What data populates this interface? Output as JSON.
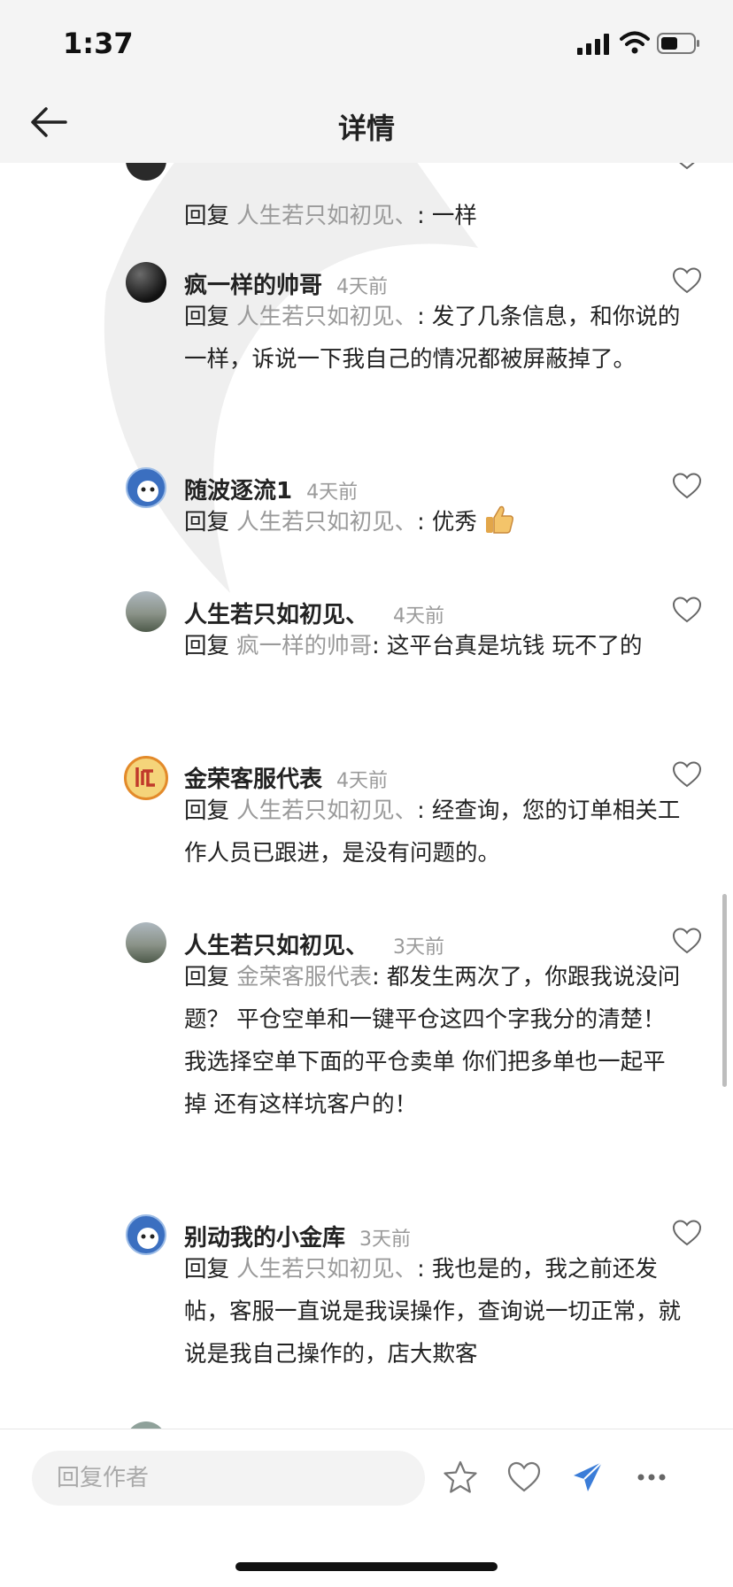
{
  "status_bar": {
    "time": "1:37"
  },
  "header": {
    "title": "详情"
  },
  "partial_top_reply": {
    "reply_word": "回复",
    "reply_target": "人生若只如初见、",
    "text": ": 一样"
  },
  "comments": [
    {
      "name": "疯一样的帅哥",
      "time": "4天前",
      "reply_word": "回复",
      "reply_target": "人生若只如初见、",
      "text": ": 发了几条信息，和你说的一样，诉说一下我自己的情况都被屏蔽掉了。"
    },
    {
      "name": "随波逐流1",
      "time": "4天前",
      "reply_word": "回复",
      "reply_target": "人生若只如初见、",
      "text": ": 优秀"
    },
    {
      "name": "人生若只如初见、",
      "time": "4天前",
      "reply_word": "回复",
      "reply_target": "疯一样的帅哥",
      "text": ": 这平台真是坑钱 玩不了的"
    },
    {
      "name": "金荣客服代表",
      "time": "4天前",
      "reply_word": "回复",
      "reply_target": "人生若只如初见、",
      "text": ": 经查询，您的订单相关工作人员已跟进，是没有问题的。"
    },
    {
      "name": "人生若只如初见、",
      "time": "3天前",
      "reply_word": "回复",
      "reply_target": "金荣客服代表",
      "text": ": 都发生两次了，你跟我说没问题？ 平仓空单和一键平仓这四个字我分的清楚！ 我选择空单下面的平仓卖单 你们把多单也一起平掉 还有这样坑客户的！"
    },
    {
      "name": "别动我的小金库",
      "time": "3天前",
      "reply_word": "回复",
      "reply_target": "人生若只如初见、",
      "text": ": 我也是的，我之前还发帖，客服一直说是我误操作，查询说一切正常，就说是我自己操作的，店大欺客"
    }
  ],
  "bottom_bar": {
    "reply_placeholder": "回复作者"
  }
}
